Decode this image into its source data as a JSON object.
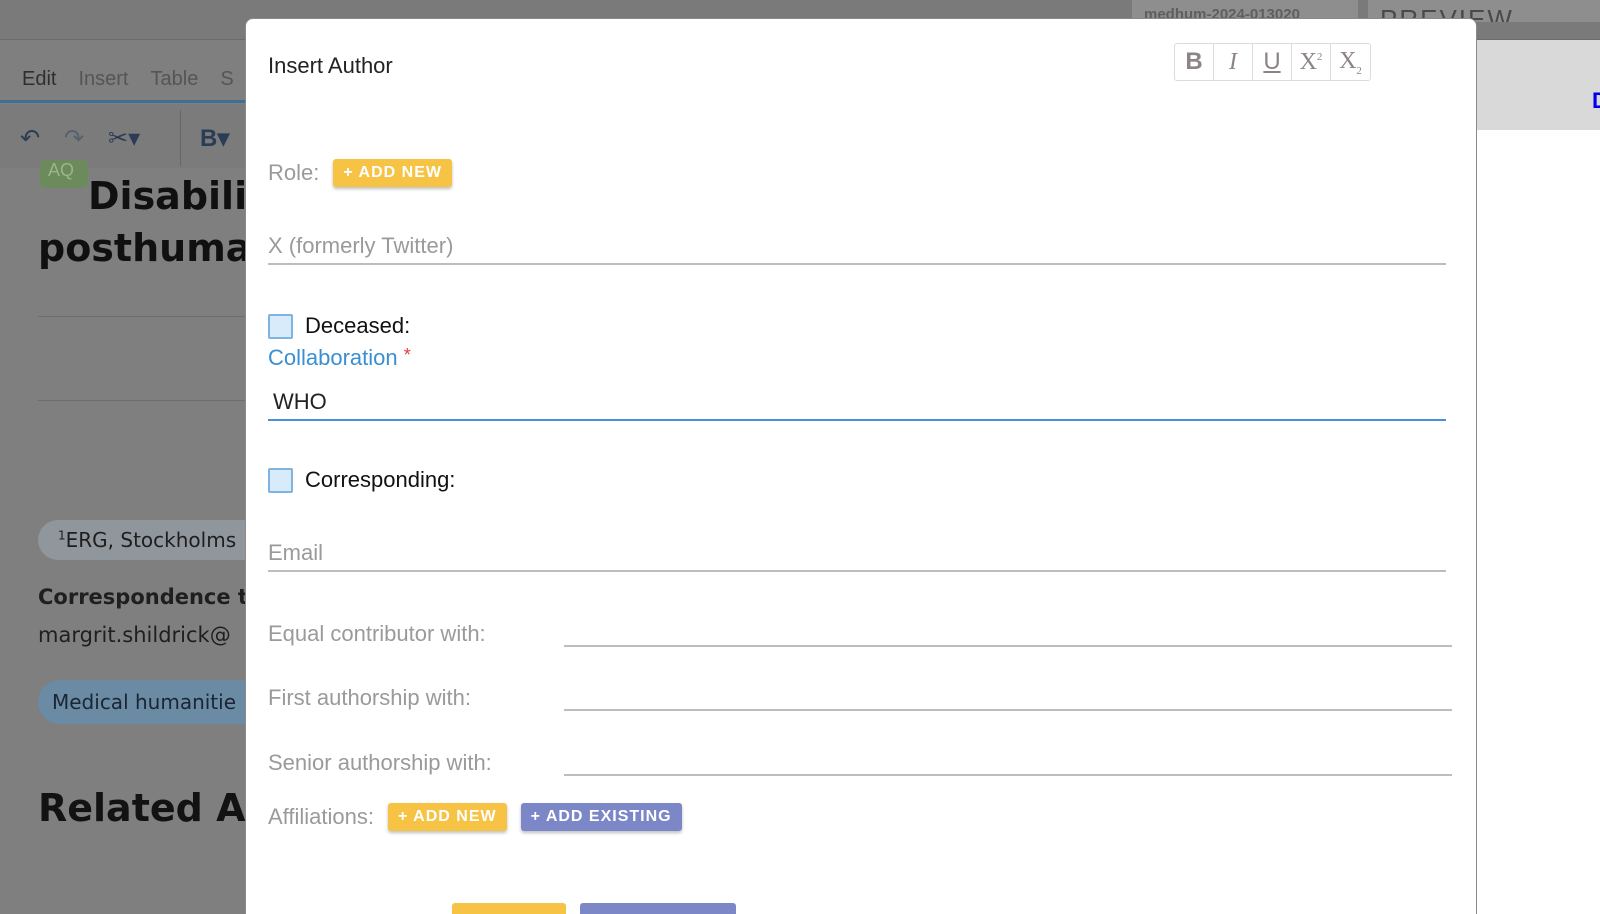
{
  "background": {
    "doc_id": "medhum-2024-013020",
    "preview_tab": "PREVIEW",
    "menu": [
      "Edit",
      "Insert",
      "Table",
      "S"
    ],
    "title_lines": [
      "Disabilit",
      "posthuman"
    ],
    "aq_badge": "AQ",
    "affiliation_num": "1",
    "affiliation": "ERG, Stockholms",
    "correspondence_label": "Correspondence t",
    "correspondence_email": "margrit.shildrick@",
    "subject": "Medical humanitie",
    "related_heading": "Related Ar",
    "right_glyph": "D"
  },
  "modal": {
    "title": "Insert Author",
    "format_buttons": [
      {
        "name": "bold",
        "glyph": "B"
      },
      {
        "name": "italic",
        "glyph": "I"
      },
      {
        "name": "underline",
        "glyph": "U"
      },
      {
        "name": "superscript",
        "glyph": "X",
        "mark": "2"
      },
      {
        "name": "subscript",
        "glyph": "X",
        "mark": "2"
      }
    ],
    "role_label": "Role:",
    "add_new_label": "+ ADD NEW",
    "twitter_placeholder": "X (formerly Twitter)",
    "deceased_label": "Deceased:",
    "collaboration_label": "Collaboration",
    "required_mark": "*",
    "collaboration_value": "WHO",
    "corresponding_label": "Corresponding:",
    "email_placeholder": "Email",
    "equal_contributor_label": "Equal contributor with:",
    "first_authorship_label": "First authorship with:",
    "senior_authorship_label": "Senior authorship with:",
    "affiliations_label": "Affiliations:",
    "add_existing_label": "+ ADD EXISTING"
  }
}
